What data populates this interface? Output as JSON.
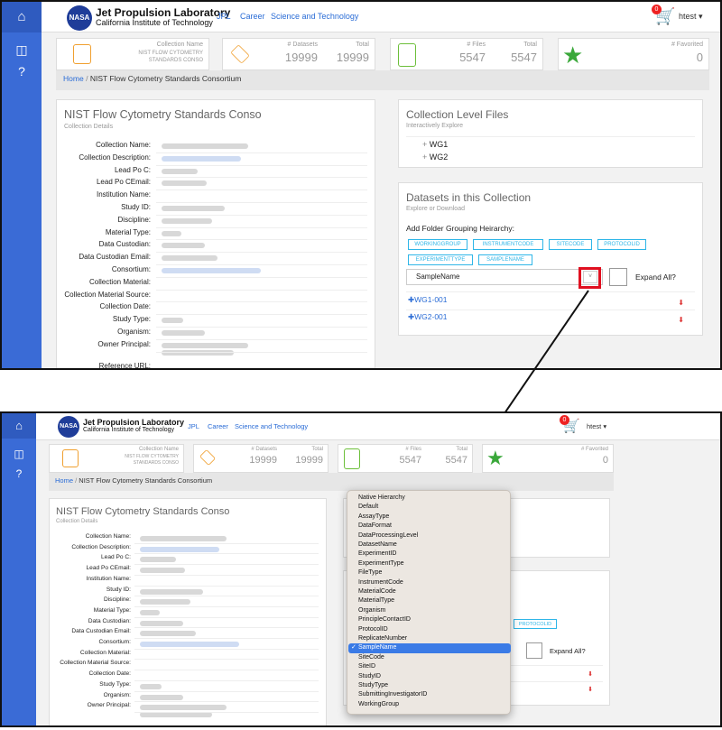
{
  "header": {
    "logo_text": "NASA",
    "brand_line1": "Jet Propulsion Laboratory",
    "brand_line2": "California Institute of Technology",
    "nav": [
      "JPL",
      "Career",
      "Science and Technology"
    ],
    "cart_count": "0",
    "user": "htest",
    "user_caret": "▾"
  },
  "sidebar": {
    "icons": [
      "home-icon",
      "cube-icon",
      "help-icon"
    ]
  },
  "stats": {
    "collection_name_label": "Collection Name",
    "collection_name_value": "NIST FLOW CYTOMETRY STANDARDS CONSO",
    "datasets_label": "# Datasets",
    "datasets_value": "19999",
    "datasets_total_label": "Total",
    "datasets_total_value": "19999",
    "files_label": "# Files",
    "files_value": "5547",
    "files_total_label": "Total",
    "files_total_value": "5547",
    "favorited_label": "# Favorited",
    "favorited_value": "0"
  },
  "breadcrumb": {
    "home": "Home",
    "separator": "/",
    "current": "NIST Flow Cytometry Standards Consortium"
  },
  "details": {
    "title": "NIST Flow Cytometry Standards Conso",
    "subtitle": "Collection Details",
    "fields": [
      "Collection Name:",
      "Collection Description:",
      "Lead Po C:",
      "Lead Po CEmail:",
      "Institution Name:",
      "Study ID:",
      "Discipline:",
      "Material Type:",
      "Data Custodian:",
      "Data Custodian Email:",
      "Consortium:",
      "Collection Material:",
      "Collection Material Source:",
      "Collection Date:",
      "Study Type:",
      "Organism:",
      "Owner Principal:"
    ],
    "reference_url_label": "Reference URL:"
  },
  "files_panel": {
    "title": "Collection Level Files",
    "subtitle": "Interactively Explore",
    "items": [
      "WG1",
      "WG2"
    ],
    "expand_symbol": "+"
  },
  "datasets_panel": {
    "title": "Datasets in this Collection",
    "subtitle": "Explore or Download",
    "grouping_label": "Add Folder Grouping Heirarchy:",
    "tags": [
      "WORKINGGROUP",
      "INSTRUMENTCODE",
      "SITECODE",
      "PROTOCOLID",
      "EXPERIMENTTYPE",
      "SAMPLENAME"
    ],
    "select_value": "SampleName",
    "expand_all": "Expand All?",
    "datasets": [
      "WG1-001",
      "WG2-001"
    ]
  },
  "dropdown": {
    "selected": "SampleName",
    "options": [
      "Native Hierarchy",
      "Default",
      "AssayType",
      "DataFormat",
      "DataProcessingLevel",
      "DatasetName",
      "ExperimentID",
      "ExperimentType",
      "FileType",
      "InstrumentCode",
      "MaterialCode",
      "MaterialType",
      "Organism",
      "PrincipleContactID",
      "ProtocolID",
      "ReplicateNumber",
      "SampleName",
      "SiteCode",
      "SiteID",
      "StudyID",
      "StudyType",
      "SubmittingInvestigatorID",
      "WorkingGroup"
    ]
  },
  "colors": {
    "sidebar": "#3a6bd6",
    "link": "#2a6cd6",
    "tag": "#2fb6e8",
    "highlight": "#e01020",
    "menu_selected": "#3b7be6"
  }
}
